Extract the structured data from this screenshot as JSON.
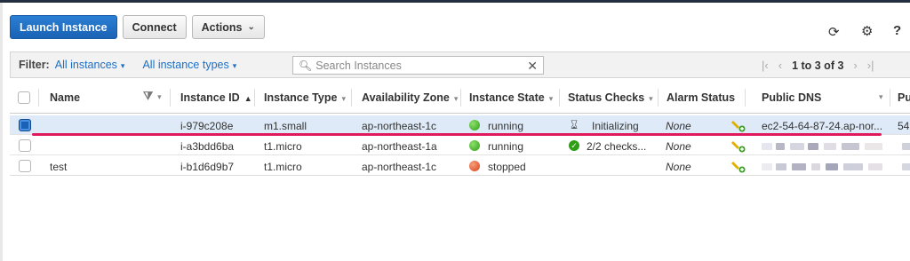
{
  "toolbar": {
    "launch_label": "Launch Instance",
    "connect_label": "Connect",
    "actions_label": "Actions"
  },
  "filter": {
    "label": "Filter:",
    "instances_filter": "All instances",
    "types_filter": "All instance types",
    "search_placeholder": "Search Instances",
    "pagination": "1 to 3 of 3"
  },
  "columns": {
    "name": "Name",
    "instance_id": "Instance ID",
    "instance_type": "Instance Type",
    "availability_zone": "Availability Zone",
    "instance_state": "Instance State",
    "status_checks": "Status Checks",
    "alarm_status": "Alarm Status",
    "public_dns": "Public DNS",
    "truncated_col": "Pu"
  },
  "rows": [
    {
      "name": "",
      "instance_id": "i-979c208e",
      "instance_type": "m1.small",
      "availability_zone": "ap-northeast-1c",
      "instance_state": "running",
      "state_color": "#2e9e17",
      "status_checks": "Initializing",
      "alarm_status": "None",
      "public_dns": "ec2-54-64-87-24.ap-nor...",
      "truncated": "54.",
      "selected": true
    },
    {
      "name": "",
      "instance_id": "i-a3bdd6ba",
      "instance_type": "t1.micro",
      "availability_zone": "ap-northeast-1a",
      "instance_state": "running",
      "state_color": "#2e9e17",
      "status_checks": "2/2 checks...",
      "alarm_status": "None",
      "selected": false
    },
    {
      "name": "test",
      "instance_id": "i-b1d6d9b7",
      "instance_type": "t1.micro",
      "availability_zone": "ap-northeast-1c",
      "instance_state": "stopped",
      "state_color": "#d9401a",
      "status_checks": "",
      "alarm_status": "None",
      "selected": false
    }
  ],
  "colors": {
    "primary": "#1a62b5",
    "link": "#1d6fc4",
    "selected_row": "#dfeaf8",
    "highlight_underline": "#e0185c"
  },
  "icons": [
    "refresh-icon",
    "gear-icon",
    "help-icon",
    "search-icon",
    "clear-icon",
    "first-page-icon",
    "prev-page-icon",
    "next-page-icon",
    "last-page-icon",
    "filter-funnel-icon",
    "hourglass-icon",
    "check-icon",
    "alarm-add-icon"
  ]
}
